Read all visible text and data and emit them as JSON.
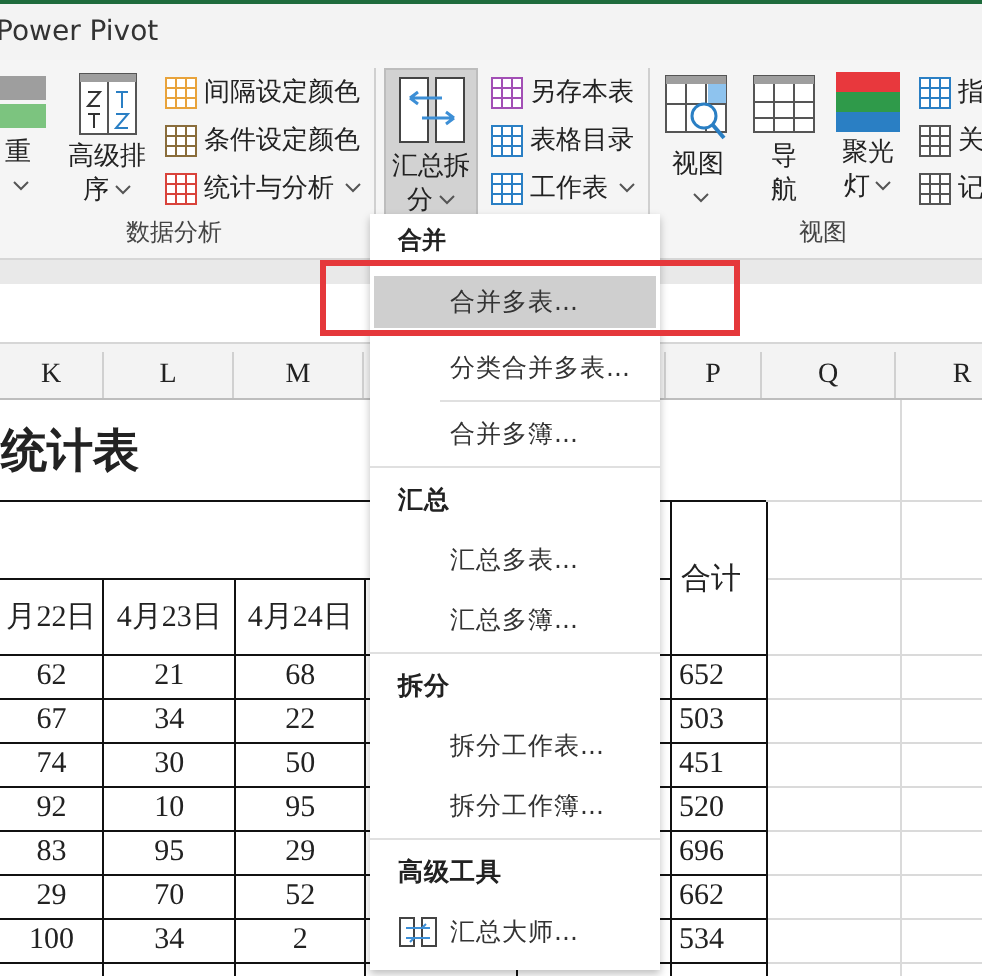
{
  "ribbon": {
    "tab": "Power Pivot",
    "groups": [
      {
        "label": "数据分析",
        "buttons": [
          {
            "lines": [
              "重"
            ],
            "dropdown": true,
            "pressed": false
          },
          {
            "lines": [
              "高级排",
              "序"
            ],
            "dropdown": true,
            "pressed": false
          }
        ],
        "items": [
          {
            "label": "间隔设定颜色",
            "dropdown": false
          },
          {
            "label": "条件设定颜色",
            "dropdown": false
          },
          {
            "label": "统计与分析",
            "dropdown": true
          }
        ]
      },
      {
        "buttons": [
          {
            "lines": [
              "汇总拆",
              "分"
            ],
            "dropdown": true,
            "pressed": true
          }
        ],
        "items": [
          {
            "label": "另存本表",
            "dropdown": false
          },
          {
            "label": "表格目录",
            "dropdown": false
          },
          {
            "label": "工作表",
            "dropdown": true
          }
        ]
      },
      {
        "label": "视图",
        "buttons": [
          {
            "lines": [
              "视图"
            ],
            "dropdown": true,
            "pressed": false
          },
          {
            "lines": [
              "导",
              "航"
            ],
            "dropdown": false,
            "pressed": false
          },
          {
            "lines": [
              "聚光",
              "灯"
            ],
            "dropdown": true,
            "pressed": false
          }
        ],
        "items": [
          {
            "label": "指",
            "dropdown": false
          },
          {
            "label": "关",
            "dropdown": false
          },
          {
            "label": "记",
            "dropdown": false
          }
        ]
      }
    ]
  },
  "sheet": {
    "columns": [
      "K",
      "L",
      "M",
      "P",
      "Q",
      "R"
    ],
    "title": "统计表",
    "date_headers": [
      "月22日",
      "4月23日",
      "4月24日"
    ],
    "total_header": "合计",
    "rows": [
      {
        "values": [
          "62",
          "21",
          "68"
        ],
        "total": "652"
      },
      {
        "values": [
          "67",
          "34",
          "22"
        ],
        "total": "503"
      },
      {
        "values": [
          "74",
          "30",
          "50"
        ],
        "total": "451"
      },
      {
        "values": [
          "92",
          "10",
          "95"
        ],
        "total": "520"
      },
      {
        "values": [
          "83",
          "95",
          "29"
        ],
        "total": "696"
      },
      {
        "values": [
          "29",
          "70",
          "52"
        ],
        "total": "662"
      },
      {
        "values": [
          "100",
          "34",
          "2"
        ],
        "total": "534"
      }
    ]
  },
  "menu": {
    "entries": [
      {
        "kind": "header",
        "label": "合并"
      },
      {
        "kind": "item",
        "label": "合并多表...",
        "selected": true
      },
      {
        "kind": "item",
        "label": "分类合并多表...",
        "selected": false
      },
      {
        "kind": "divider",
        "inset": true
      },
      {
        "kind": "item",
        "label": "合并多簿...",
        "selected": false
      },
      {
        "kind": "divider",
        "inset": false
      },
      {
        "kind": "header",
        "label": "汇总"
      },
      {
        "kind": "item",
        "label": "汇总多表...",
        "selected": false
      },
      {
        "kind": "item",
        "label": "汇总多簿...",
        "selected": false
      },
      {
        "kind": "divider",
        "inset": false
      },
      {
        "kind": "header",
        "label": "拆分"
      },
      {
        "kind": "item",
        "label": "拆分工作表...",
        "selected": false
      },
      {
        "kind": "item",
        "label": "拆分工作簿...",
        "selected": false
      },
      {
        "kind": "divider",
        "inset": false
      },
      {
        "kind": "header",
        "label": "高级工具"
      },
      {
        "kind": "icon-item",
        "label": "汇总大师...",
        "selected": false
      }
    ]
  }
}
